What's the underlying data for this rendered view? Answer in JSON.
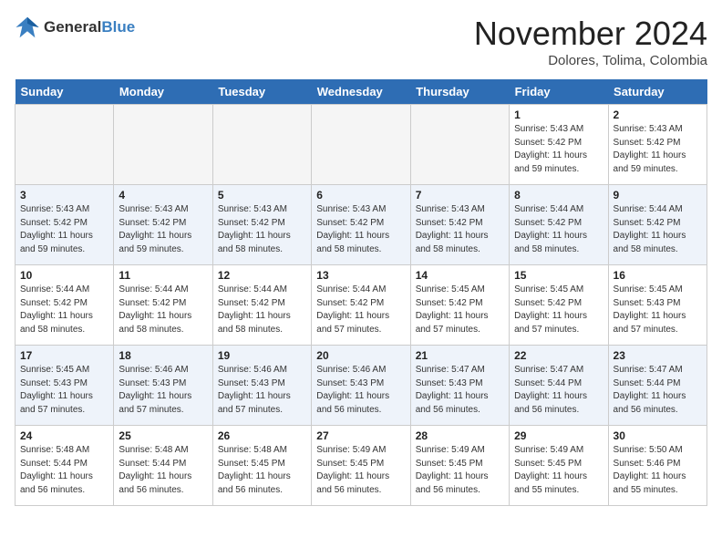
{
  "logo": {
    "line1": "General",
    "line2": "Blue"
  },
  "title": "November 2024",
  "location": "Dolores, Tolima, Colombia",
  "days_of_week": [
    "Sunday",
    "Monday",
    "Tuesday",
    "Wednesday",
    "Thursday",
    "Friday",
    "Saturday"
  ],
  "weeks": [
    [
      {
        "day": "",
        "empty": true
      },
      {
        "day": "",
        "empty": true
      },
      {
        "day": "",
        "empty": true
      },
      {
        "day": "",
        "empty": true
      },
      {
        "day": "",
        "empty": true
      },
      {
        "day": "1",
        "info": "Sunrise: 5:43 AM\nSunset: 5:42 PM\nDaylight: 11 hours\nand 59 minutes."
      },
      {
        "day": "2",
        "info": "Sunrise: 5:43 AM\nSunset: 5:42 PM\nDaylight: 11 hours\nand 59 minutes."
      }
    ],
    [
      {
        "day": "3",
        "info": "Sunrise: 5:43 AM\nSunset: 5:42 PM\nDaylight: 11 hours\nand 59 minutes."
      },
      {
        "day": "4",
        "info": "Sunrise: 5:43 AM\nSunset: 5:42 PM\nDaylight: 11 hours\nand 59 minutes."
      },
      {
        "day": "5",
        "info": "Sunrise: 5:43 AM\nSunset: 5:42 PM\nDaylight: 11 hours\nand 58 minutes."
      },
      {
        "day": "6",
        "info": "Sunrise: 5:43 AM\nSunset: 5:42 PM\nDaylight: 11 hours\nand 58 minutes."
      },
      {
        "day": "7",
        "info": "Sunrise: 5:43 AM\nSunset: 5:42 PM\nDaylight: 11 hours\nand 58 minutes."
      },
      {
        "day": "8",
        "info": "Sunrise: 5:44 AM\nSunset: 5:42 PM\nDaylight: 11 hours\nand 58 minutes."
      },
      {
        "day": "9",
        "info": "Sunrise: 5:44 AM\nSunset: 5:42 PM\nDaylight: 11 hours\nand 58 minutes."
      }
    ],
    [
      {
        "day": "10",
        "info": "Sunrise: 5:44 AM\nSunset: 5:42 PM\nDaylight: 11 hours\nand 58 minutes."
      },
      {
        "day": "11",
        "info": "Sunrise: 5:44 AM\nSunset: 5:42 PM\nDaylight: 11 hours\nand 58 minutes."
      },
      {
        "day": "12",
        "info": "Sunrise: 5:44 AM\nSunset: 5:42 PM\nDaylight: 11 hours\nand 58 minutes."
      },
      {
        "day": "13",
        "info": "Sunrise: 5:44 AM\nSunset: 5:42 PM\nDaylight: 11 hours\nand 57 minutes."
      },
      {
        "day": "14",
        "info": "Sunrise: 5:45 AM\nSunset: 5:42 PM\nDaylight: 11 hours\nand 57 minutes."
      },
      {
        "day": "15",
        "info": "Sunrise: 5:45 AM\nSunset: 5:42 PM\nDaylight: 11 hours\nand 57 minutes."
      },
      {
        "day": "16",
        "info": "Sunrise: 5:45 AM\nSunset: 5:43 PM\nDaylight: 11 hours\nand 57 minutes."
      }
    ],
    [
      {
        "day": "17",
        "info": "Sunrise: 5:45 AM\nSunset: 5:43 PM\nDaylight: 11 hours\nand 57 minutes."
      },
      {
        "day": "18",
        "info": "Sunrise: 5:46 AM\nSunset: 5:43 PM\nDaylight: 11 hours\nand 57 minutes."
      },
      {
        "day": "19",
        "info": "Sunrise: 5:46 AM\nSunset: 5:43 PM\nDaylight: 11 hours\nand 57 minutes."
      },
      {
        "day": "20",
        "info": "Sunrise: 5:46 AM\nSunset: 5:43 PM\nDaylight: 11 hours\nand 56 minutes."
      },
      {
        "day": "21",
        "info": "Sunrise: 5:47 AM\nSunset: 5:43 PM\nDaylight: 11 hours\nand 56 minutes."
      },
      {
        "day": "22",
        "info": "Sunrise: 5:47 AM\nSunset: 5:44 PM\nDaylight: 11 hours\nand 56 minutes."
      },
      {
        "day": "23",
        "info": "Sunrise: 5:47 AM\nSunset: 5:44 PM\nDaylight: 11 hours\nand 56 minutes."
      }
    ],
    [
      {
        "day": "24",
        "info": "Sunrise: 5:48 AM\nSunset: 5:44 PM\nDaylight: 11 hours\nand 56 minutes."
      },
      {
        "day": "25",
        "info": "Sunrise: 5:48 AM\nSunset: 5:44 PM\nDaylight: 11 hours\nand 56 minutes."
      },
      {
        "day": "26",
        "info": "Sunrise: 5:48 AM\nSunset: 5:45 PM\nDaylight: 11 hours\nand 56 minutes."
      },
      {
        "day": "27",
        "info": "Sunrise: 5:49 AM\nSunset: 5:45 PM\nDaylight: 11 hours\nand 56 minutes."
      },
      {
        "day": "28",
        "info": "Sunrise: 5:49 AM\nSunset: 5:45 PM\nDaylight: 11 hours\nand 56 minutes."
      },
      {
        "day": "29",
        "info": "Sunrise: 5:49 AM\nSunset: 5:45 PM\nDaylight: 11 hours\nand 55 minutes."
      },
      {
        "day": "30",
        "info": "Sunrise: 5:50 AM\nSunset: 5:46 PM\nDaylight: 11 hours\nand 55 minutes."
      }
    ]
  ]
}
